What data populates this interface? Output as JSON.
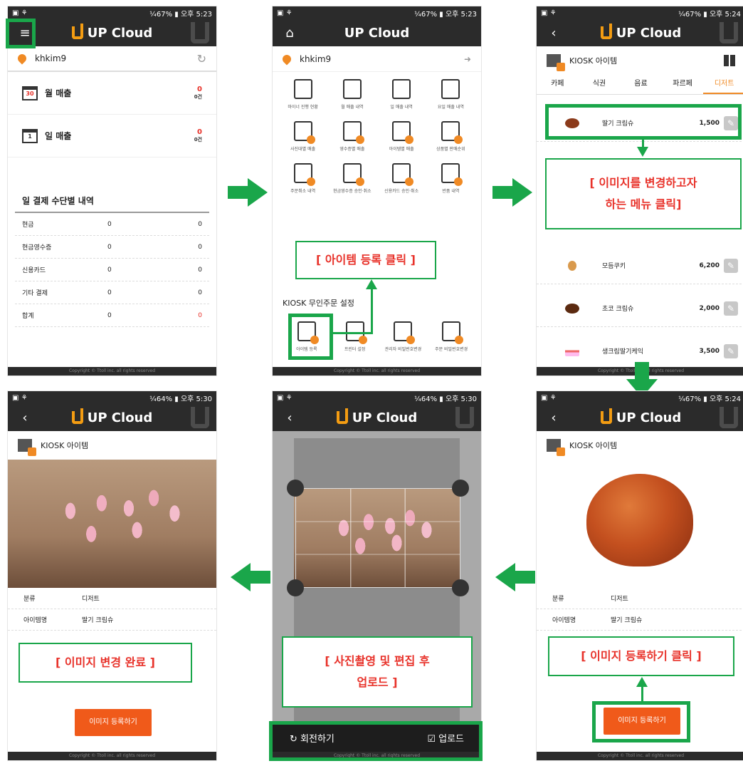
{
  "status": {
    "p1": "¼67% ▮ 오후 5:23",
    "p2": "¼67% ▮ 오후 5:23",
    "p3": "¼67% ▮ 오후 5:24",
    "p4": "¼64% ▮ 오후 5:30",
    "p5": "¼64% ▮ 오후 5:30",
    "p6": "¼67% ▮ 오후 5:24"
  },
  "app_title": "UP Cloud",
  "footer_text": "Copyright © Ttoll inc. all rights reserved",
  "user": "khkim9",
  "screen1": {
    "monthly_sales": "월 매출",
    "daily_sales": "일 매출",
    "value": "0",
    "count": "0건",
    "cal_month": "30",
    "cal_day": "1",
    "pay_title": "일 결제 수단별 내역",
    "pay_rows": [
      {
        "label": "현금",
        "a": "0",
        "b": "0"
      },
      {
        "label": "현금영수증",
        "a": "0",
        "b": "0"
      },
      {
        "label": "신용카드",
        "a": "0",
        "b": "0"
      },
      {
        "label": "기타 결제",
        "a": "0",
        "b": "0"
      },
      {
        "label": "합계",
        "a": "0",
        "b": "0"
      }
    ]
  },
  "screen2": {
    "menu": [
      {
        "label": "마이너 진행 현황"
      },
      {
        "label": "월 매출 내역"
      },
      {
        "label": "일 매출 내역"
      },
      {
        "label": "요일 매출 내역"
      },
      {
        "label": "사진대별 매출"
      },
      {
        "label": "영수증별 매출"
      },
      {
        "label": "아이템별 매출"
      },
      {
        "label": "상품별 판매순위"
      },
      {
        "label": "주문취소 내역"
      },
      {
        "label": "현금영수증 승인·취소"
      },
      {
        "label": "신용카드 승인·취소"
      },
      {
        "label": "반품 내역"
      }
    ],
    "kiosk_title": "KIOSK 무인주문 설정",
    "kiosk_menu": [
      {
        "label": "아이템 등록"
      },
      {
        "label": "프린터 설정"
      },
      {
        "label": "관리자 비밀번호변경"
      },
      {
        "label": "주문 비밀번호변경"
      }
    ],
    "callout": "[ 아이템 등록 클릭 ]"
  },
  "screen3": {
    "header": "KIOSK 아이템",
    "tabs": [
      "카페",
      "식권",
      "음료",
      "파르페",
      "디저트"
    ],
    "items": [
      {
        "name": "딸기 크림슈",
        "price": "1,500"
      },
      {
        "name": "모듬쿠키",
        "price": "6,200"
      },
      {
        "name": "초코 크림슈",
        "price": "2,000"
      },
      {
        "name": "생크림딸기케익",
        "price": "3,500"
      }
    ],
    "callout_line1": "[ 이미지를 변경하고자",
    "callout_line2": "하는 메뉴 클릭]"
  },
  "detail": {
    "header": "KIOSK 아이템",
    "category_label": "분류",
    "category_value": "디저트",
    "name_label": "아이템명",
    "name_value": "딸기 크림슈",
    "register_button": "이미지 등록하기"
  },
  "screen4": {
    "callout": "[ 이미지 변경 완료 ]"
  },
  "screen5": {
    "rotate": "회전하기",
    "upload": "업로드",
    "callout_line1": "[ 사진촬영 및 편집 후",
    "callout_line2": "업로드 ]"
  },
  "screen6": {
    "callout": "[ 이미지 등록하기 클릭 ]"
  },
  "colors": {
    "accent_green": "#1aa64a",
    "accent_orange": "#f05a1a",
    "callout_red": "#e8322a",
    "appbar": "#2b2b2b"
  }
}
